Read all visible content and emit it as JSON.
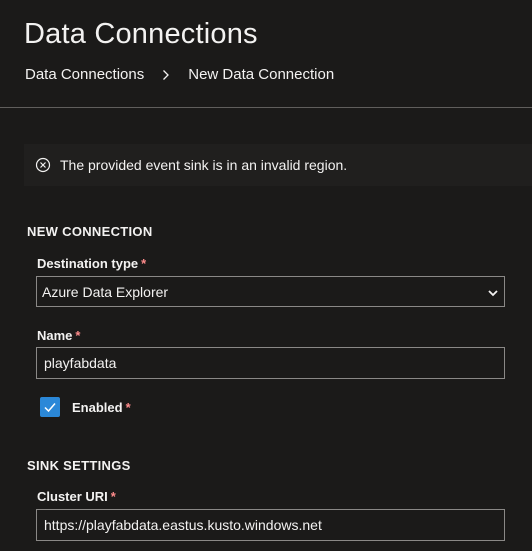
{
  "header": {
    "title": "Data Connections",
    "breadcrumb": {
      "parent": "Data Connections",
      "current": "New Data Connection"
    }
  },
  "error": {
    "message": "The provided event sink is in an invalid region.",
    "icon": "error-circle-icon"
  },
  "new_connection": {
    "section_title": "NEW CONNECTION",
    "destination_type": {
      "label": "Destination type",
      "required_mark": "*",
      "value": "Azure Data Explorer"
    },
    "name": {
      "label": "Name",
      "required_mark": "*",
      "value": "playfabdata"
    },
    "enabled": {
      "label": "Enabled",
      "required_mark": "*",
      "checked": true
    }
  },
  "sink_settings": {
    "section_title": "SINK SETTINGS",
    "cluster_uri": {
      "label": "Cluster URI",
      "required_mark": "*",
      "value": "https://playfabdata.eastus.kusto.windows.net"
    }
  },
  "colors": {
    "background": "#1b1a19",
    "accent": "#2b88d8",
    "required": "#ff8c8c",
    "border": "#8a8886"
  }
}
